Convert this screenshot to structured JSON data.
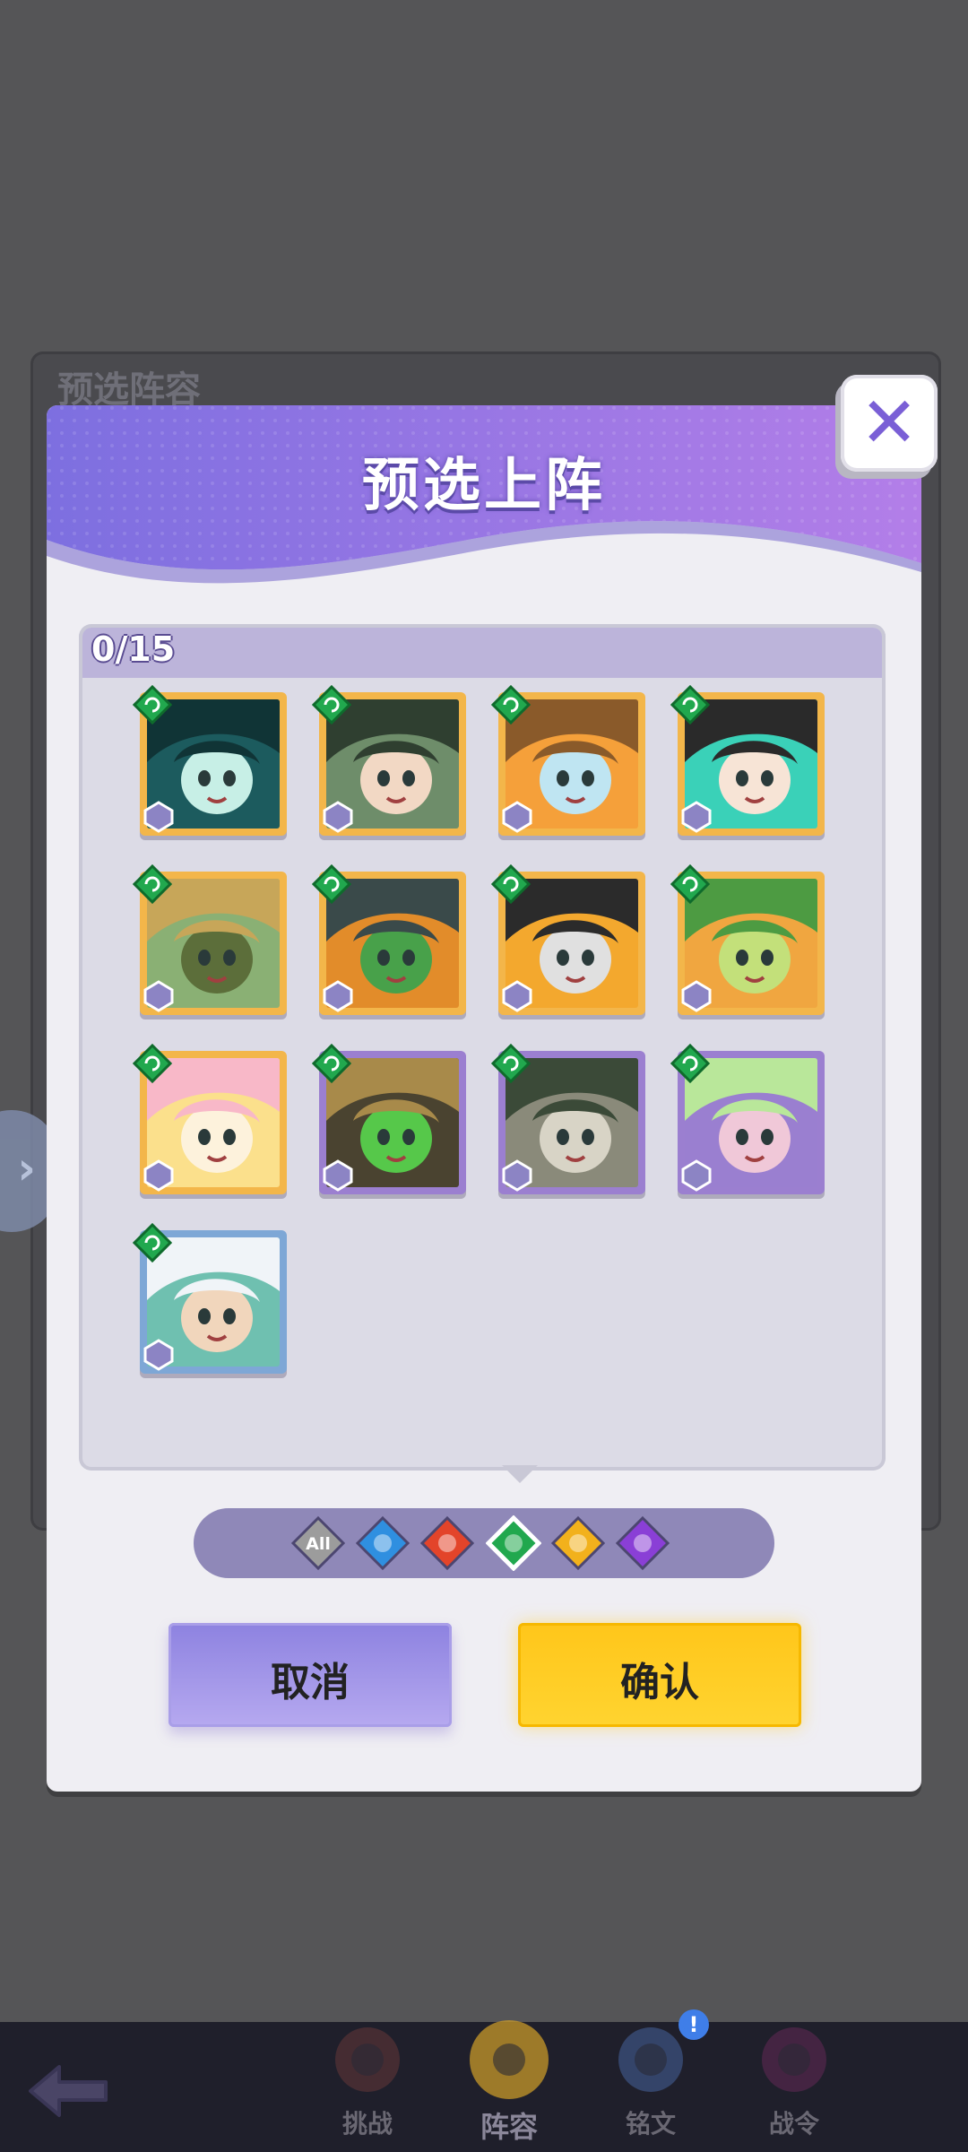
{
  "background": {
    "panel_title": "预选阵容",
    "side_tab_icon": "chevron-right-icon"
  },
  "modal": {
    "title": "预选上阵",
    "close_icon": "close-icon",
    "selection_count": "0/15",
    "heroes": [
      {
        "element": "wind",
        "class_icon": "question-class-icon",
        "frame": "gold",
        "palette": [
          "#1c5b5e",
          "#103436",
          "#c7efe6"
        ]
      },
      {
        "element": "wind",
        "class_icon": "archer-class-icon",
        "frame": "gold",
        "palette": [
          "#6e8d6a",
          "#2f3f30",
          "#f2d8c4"
        ]
      },
      {
        "element": "wind",
        "class_icon": "mage-class-icon",
        "frame": "gold",
        "palette": [
          "#f5a03a",
          "#8a5a2a",
          "#bfe5f2"
        ]
      },
      {
        "element": "wind",
        "class_icon": "mage-class-icon",
        "frame": "gold",
        "palette": [
          "#3ad1b8",
          "#2a2a2a",
          "#f7e4d6"
        ]
      },
      {
        "element": "wind",
        "class_icon": "tank-class-icon",
        "frame": "gold",
        "palette": [
          "#8ab074",
          "#c7a659",
          "#5c6e3a"
        ]
      },
      {
        "element": "wind",
        "class_icon": "question-class-icon",
        "frame": "gold",
        "palette": [
          "#e28c2a",
          "#3a4a4a",
          "#48a14a"
        ]
      },
      {
        "element": "wind",
        "class_icon": "warrior-class-icon",
        "frame": "gold",
        "palette": [
          "#f3a82e",
          "#2b2b2b",
          "#e0e0e0"
        ]
      },
      {
        "element": "wind",
        "class_icon": "tank-class-icon",
        "frame": "gold",
        "palette": [
          "#f0a640",
          "#4d9b42",
          "#c3e07a"
        ]
      },
      {
        "element": "wind",
        "class_icon": "mage-class-icon",
        "frame": "gold",
        "palette": [
          "#fbe08c",
          "#f8b8c8",
          "#fdf2dc"
        ]
      },
      {
        "element": "wind",
        "class_icon": "tank-class-icon",
        "frame": "purple",
        "palette": [
          "#4a4330",
          "#a88a4a",
          "#56c84a"
        ]
      },
      {
        "element": "wind",
        "class_icon": "warrior-class-icon",
        "frame": "purple",
        "palette": [
          "#8a8a7a",
          "#3b4a38",
          "#d8d4c6"
        ]
      },
      {
        "element": "wind",
        "class_icon": "mage-class-icon",
        "frame": "purple",
        "palette": [
          "#9a7fd0",
          "#b9e79a",
          "#f0c8d8"
        ]
      },
      {
        "element": "wind",
        "class_icon": "archer-class-icon",
        "frame": "blue",
        "palette": [
          "#6fc0b0",
          "#f0f4f8",
          "#f1d6bc"
        ]
      }
    ]
  },
  "filters": [
    {
      "name": "all",
      "label": "All",
      "color": "#9c9c9c"
    },
    {
      "name": "water",
      "label": "",
      "color": "#2f8fe0"
    },
    {
      "name": "fire",
      "label": "",
      "color": "#e3442a"
    },
    {
      "name": "wind",
      "label": "",
      "color": "#21a84e"
    },
    {
      "name": "light",
      "label": "",
      "color": "#f2b11c"
    },
    {
      "name": "dark",
      "label": "",
      "color": "#8a3fd6"
    }
  ],
  "selected_filter": "wind",
  "buttons": {
    "cancel": "取消",
    "confirm": "确认"
  },
  "nav": {
    "back_icon": "back-arrow-icon",
    "items": [
      {
        "label": "挑战",
        "icon": "challenge-icon",
        "active": false
      },
      {
        "label": "阵容",
        "icon": "lineup-icon",
        "active": true
      },
      {
        "label": "铭文",
        "icon": "inscription-icon",
        "active": false,
        "badge": "!"
      },
      {
        "label": "战令",
        "icon": "battle-pass-icon",
        "active": false
      }
    ]
  },
  "colors": {
    "modal_header": "#8e6fe0",
    "gold_frame": "#f3b64a",
    "purple_frame": "#9b7fd0",
    "confirm": "#ffc61a",
    "cancel": "#9d91e6"
  }
}
